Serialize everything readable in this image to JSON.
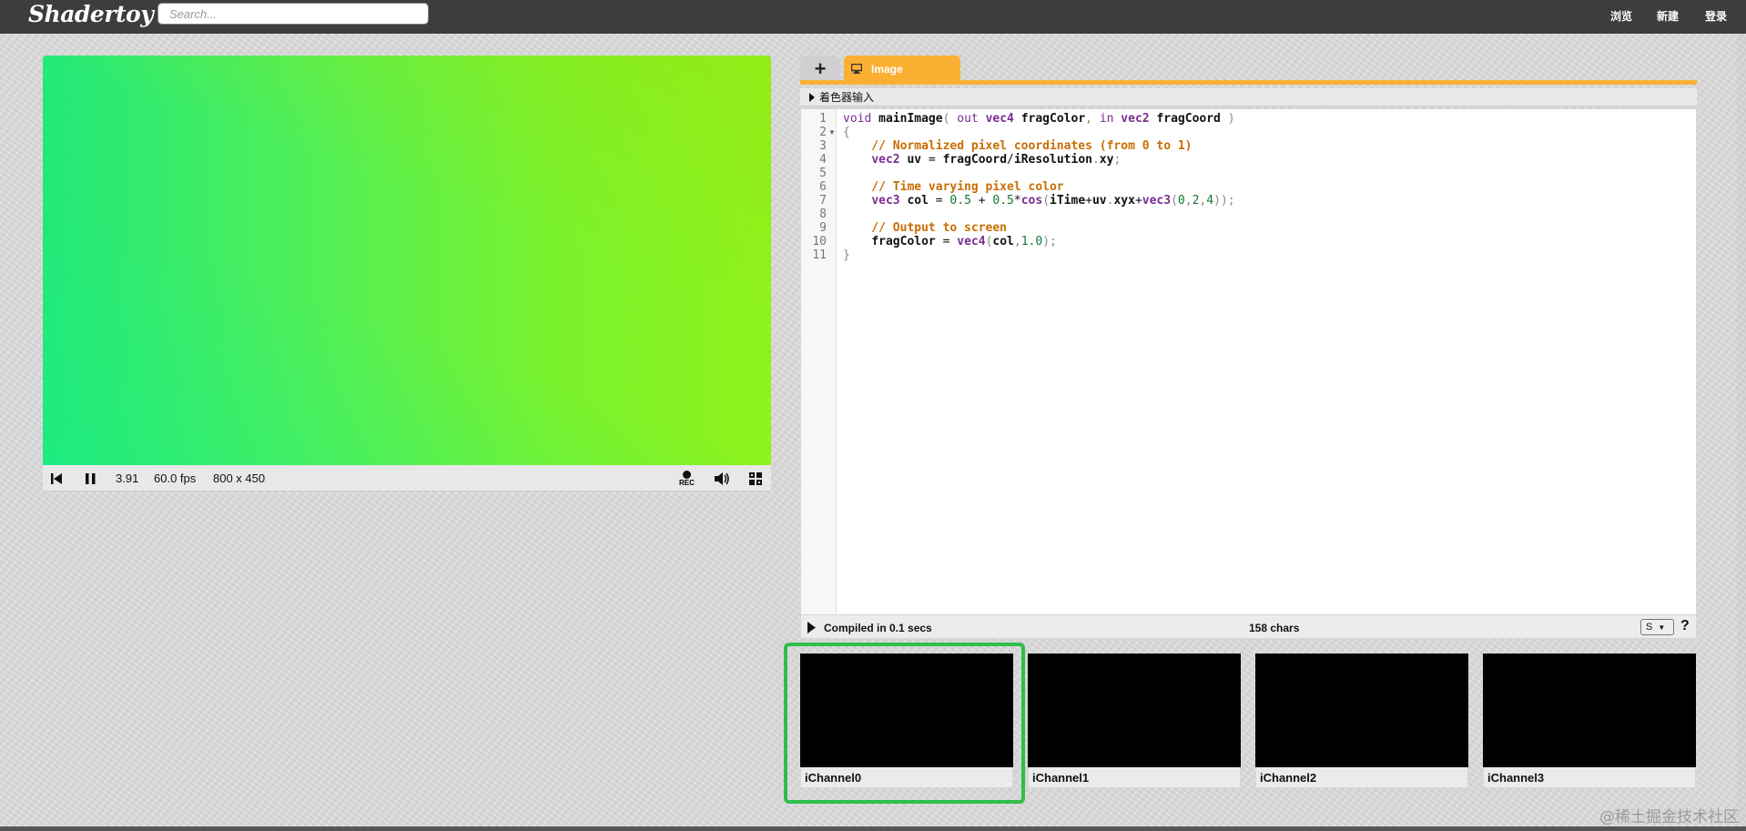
{
  "header": {
    "logo": "Shadertoy",
    "search_placeholder": "Search...",
    "nav": [
      "浏览",
      "新建",
      "登录"
    ]
  },
  "player": {
    "time": "3.91",
    "fps": "60.0 fps",
    "resolution": "800 x 450",
    "rec_label": "REC",
    "icons": [
      "rewind-icon",
      "pause-icon",
      "record-icon",
      "volume-icon",
      "fullscreen-icon"
    ]
  },
  "editor": {
    "add_tab": "+",
    "tab_label": "Image",
    "inputs_label": "着色器输入",
    "code": [
      "void mainImage( out vec4 fragColor, in vec2 fragCoord )",
      "{",
      "    // Normalized pixel coordinates (from 0 to 1)",
      "    vec2 uv = fragCoord/iResolution.xy;",
      "",
      "    // Time varying pixel color",
      "    vec3 col = 0.5 + 0.5*cos(iTime+uv.xyx+vec3(0,2,4));",
      "",
      "    // Output to screen",
      "    fragColor = vec4(col,1.0);",
      "}"
    ],
    "status_compiled": "Compiled in 0.1 secs",
    "status_chars": "158 chars",
    "font_select": "S",
    "help": "?"
  },
  "channels": [
    "iChannel0",
    "iChannel1",
    "iChannel2",
    "iChannel3"
  ],
  "watermark": "@稀土掘金技术社区",
  "colors": {
    "topbar": "#3d3d3d",
    "tab_accent": "#fbb034",
    "selected_channel": "#2fbe4a"
  }
}
